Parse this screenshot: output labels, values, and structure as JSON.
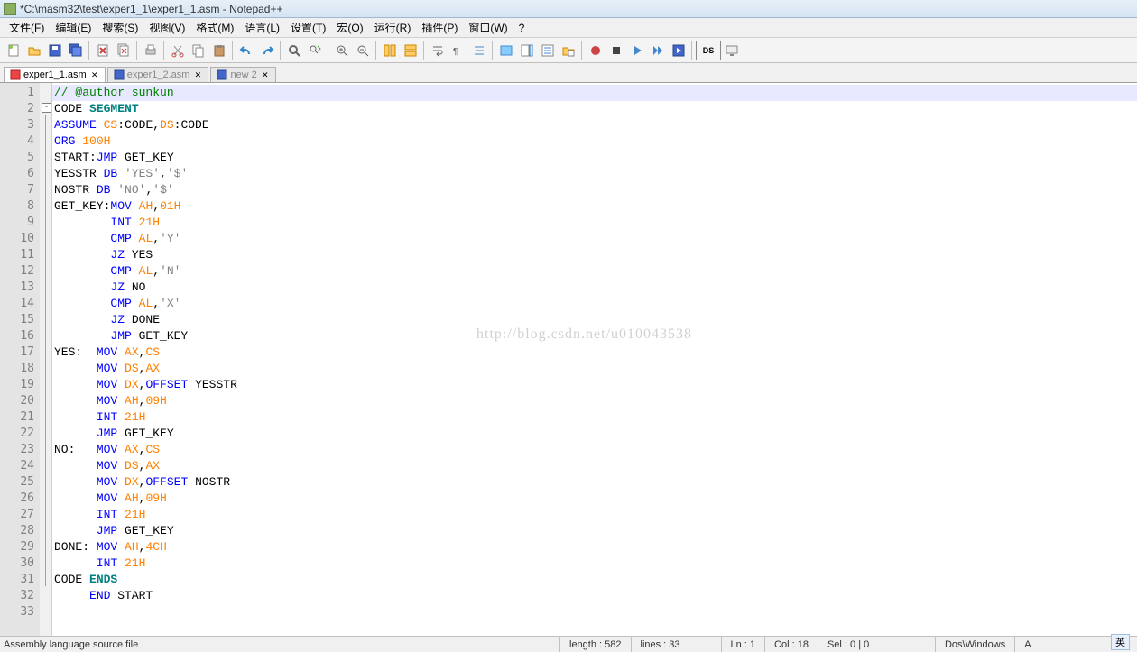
{
  "title": "*C:\\masm32\\test\\exper1_1\\exper1_1.asm - Notepad++",
  "menus": [
    "文件(F)",
    "编辑(E)",
    "搜索(S)",
    "视图(V)",
    "格式(M)",
    "语言(L)",
    "设置(T)",
    "宏(O)",
    "运行(R)",
    "插件(P)",
    "窗口(W)",
    "?"
  ],
  "tabs": [
    {
      "label": "exper1_1.asm",
      "active": true,
      "modified": true
    },
    {
      "label": "exper1_2.asm",
      "active": false,
      "modified": false
    },
    {
      "label": "new  2",
      "active": false,
      "modified": false
    }
  ],
  "watermark": "http://blog.csdn.net/u010043538",
  "code": [
    {
      "n": 1,
      "segs": [
        {
          "t": "// @author sunkun",
          "c": "kw-comment"
        }
      ]
    },
    {
      "n": 2,
      "segs": [
        {
          "t": "CODE "
        },
        {
          "t": "SEGMENT",
          "c": "kw-teal"
        }
      ]
    },
    {
      "n": 3,
      "segs": [
        {
          "t": "ASSUME",
          "c": "kw-blue"
        },
        {
          "t": " "
        },
        {
          "t": "CS",
          "c": "kw-orange"
        },
        {
          "t": ":CODE,"
        },
        {
          "t": "DS",
          "c": "kw-orange"
        },
        {
          "t": ":CODE"
        }
      ]
    },
    {
      "n": 4,
      "segs": [
        {
          "t": "ORG",
          "c": "kw-blue"
        },
        {
          "t": " "
        },
        {
          "t": "100H",
          "c": "kw-orange"
        }
      ]
    },
    {
      "n": 5,
      "segs": [
        {
          "t": "START:"
        },
        {
          "t": "JMP",
          "c": "kw-blue"
        },
        {
          "t": " GET_KEY"
        }
      ]
    },
    {
      "n": 6,
      "segs": [
        {
          "t": "YESSTR "
        },
        {
          "t": "DB",
          "c": "kw-blue"
        },
        {
          "t": " "
        },
        {
          "t": "'YES'",
          "c": "kw-str"
        },
        {
          "t": ","
        },
        {
          "t": "'$'",
          "c": "kw-str"
        }
      ]
    },
    {
      "n": 7,
      "segs": [
        {
          "t": "NOSTR "
        },
        {
          "t": "DB",
          "c": "kw-blue"
        },
        {
          "t": " "
        },
        {
          "t": "'NO'",
          "c": "kw-str"
        },
        {
          "t": ","
        },
        {
          "t": "'$'",
          "c": "kw-str"
        }
      ]
    },
    {
      "n": 8,
      "segs": [
        {
          "t": "GET_KEY:"
        },
        {
          "t": "MOV",
          "c": "kw-blue"
        },
        {
          "t": " "
        },
        {
          "t": "AH",
          "c": "kw-orange"
        },
        {
          "t": ","
        },
        {
          "t": "01H",
          "c": "kw-orange"
        }
      ]
    },
    {
      "n": 9,
      "segs": [
        {
          "t": "        "
        },
        {
          "t": "INT",
          "c": "kw-blue"
        },
        {
          "t": " "
        },
        {
          "t": "21H",
          "c": "kw-orange"
        }
      ]
    },
    {
      "n": 10,
      "segs": [
        {
          "t": "        "
        },
        {
          "t": "CMP",
          "c": "kw-blue"
        },
        {
          "t": " "
        },
        {
          "t": "AL",
          "c": "kw-orange"
        },
        {
          "t": ","
        },
        {
          "t": "'Y'",
          "c": "kw-str"
        }
      ]
    },
    {
      "n": 11,
      "segs": [
        {
          "t": "        "
        },
        {
          "t": "JZ",
          "c": "kw-blue"
        },
        {
          "t": " YES"
        }
      ]
    },
    {
      "n": 12,
      "segs": [
        {
          "t": "        "
        },
        {
          "t": "CMP",
          "c": "kw-blue"
        },
        {
          "t": " "
        },
        {
          "t": "AL",
          "c": "kw-orange"
        },
        {
          "t": ","
        },
        {
          "t": "'N'",
          "c": "kw-str"
        }
      ]
    },
    {
      "n": 13,
      "segs": [
        {
          "t": "        "
        },
        {
          "t": "JZ",
          "c": "kw-blue"
        },
        {
          "t": " NO"
        }
      ]
    },
    {
      "n": 14,
      "segs": [
        {
          "t": "        "
        },
        {
          "t": "CMP",
          "c": "kw-blue"
        },
        {
          "t": " "
        },
        {
          "t": "AL",
          "c": "kw-orange"
        },
        {
          "t": ","
        },
        {
          "t": "'X'",
          "c": "kw-str"
        }
      ]
    },
    {
      "n": 15,
      "segs": [
        {
          "t": "        "
        },
        {
          "t": "JZ",
          "c": "kw-blue"
        },
        {
          "t": " DONE"
        }
      ]
    },
    {
      "n": 16,
      "segs": [
        {
          "t": "        "
        },
        {
          "t": "JMP",
          "c": "kw-blue"
        },
        {
          "t": " GET_KEY"
        }
      ]
    },
    {
      "n": 17,
      "segs": [
        {
          "t": "YES:  "
        },
        {
          "t": "MOV",
          "c": "kw-blue"
        },
        {
          "t": " "
        },
        {
          "t": "AX",
          "c": "kw-orange"
        },
        {
          "t": ","
        },
        {
          "t": "CS",
          "c": "kw-orange"
        }
      ]
    },
    {
      "n": 18,
      "segs": [
        {
          "t": "      "
        },
        {
          "t": "MOV",
          "c": "kw-blue"
        },
        {
          "t": " "
        },
        {
          "t": "DS",
          "c": "kw-orange"
        },
        {
          "t": ","
        },
        {
          "t": "AX",
          "c": "kw-orange"
        }
      ]
    },
    {
      "n": 19,
      "segs": [
        {
          "t": "      "
        },
        {
          "t": "MOV",
          "c": "kw-blue"
        },
        {
          "t": " "
        },
        {
          "t": "DX",
          "c": "kw-orange"
        },
        {
          "t": ","
        },
        {
          "t": "OFFSET",
          "c": "kw-blue"
        },
        {
          "t": " YESSTR"
        }
      ]
    },
    {
      "n": 20,
      "segs": [
        {
          "t": "      "
        },
        {
          "t": "MOV",
          "c": "kw-blue"
        },
        {
          "t": " "
        },
        {
          "t": "AH",
          "c": "kw-orange"
        },
        {
          "t": ","
        },
        {
          "t": "09H",
          "c": "kw-orange"
        }
      ]
    },
    {
      "n": 21,
      "segs": [
        {
          "t": "      "
        },
        {
          "t": "INT",
          "c": "kw-blue"
        },
        {
          "t": " "
        },
        {
          "t": "21H",
          "c": "kw-orange"
        }
      ]
    },
    {
      "n": 22,
      "segs": [
        {
          "t": "      "
        },
        {
          "t": "JMP",
          "c": "kw-blue"
        },
        {
          "t": " GET_KEY"
        }
      ]
    },
    {
      "n": 23,
      "segs": [
        {
          "t": "NO:   "
        },
        {
          "t": "MOV",
          "c": "kw-blue"
        },
        {
          "t": " "
        },
        {
          "t": "AX",
          "c": "kw-orange"
        },
        {
          "t": ","
        },
        {
          "t": "CS",
          "c": "kw-orange"
        }
      ]
    },
    {
      "n": 24,
      "segs": [
        {
          "t": "      "
        },
        {
          "t": "MOV",
          "c": "kw-blue"
        },
        {
          "t": " "
        },
        {
          "t": "DS",
          "c": "kw-orange"
        },
        {
          "t": ","
        },
        {
          "t": "AX",
          "c": "kw-orange"
        }
      ]
    },
    {
      "n": 25,
      "segs": [
        {
          "t": "      "
        },
        {
          "t": "MOV",
          "c": "kw-blue"
        },
        {
          "t": " "
        },
        {
          "t": "DX",
          "c": "kw-orange"
        },
        {
          "t": ","
        },
        {
          "t": "OFFSET",
          "c": "kw-blue"
        },
        {
          "t": " NOSTR"
        }
      ]
    },
    {
      "n": 26,
      "segs": [
        {
          "t": "      "
        },
        {
          "t": "MOV",
          "c": "kw-blue"
        },
        {
          "t": " "
        },
        {
          "t": "AH",
          "c": "kw-orange"
        },
        {
          "t": ","
        },
        {
          "t": "09H",
          "c": "kw-orange"
        }
      ]
    },
    {
      "n": 27,
      "segs": [
        {
          "t": "      "
        },
        {
          "t": "INT",
          "c": "kw-blue"
        },
        {
          "t": " "
        },
        {
          "t": "21H",
          "c": "kw-orange"
        }
      ]
    },
    {
      "n": 28,
      "segs": [
        {
          "t": "      "
        },
        {
          "t": "JMP",
          "c": "kw-blue"
        },
        {
          "t": " GET_KEY"
        }
      ]
    },
    {
      "n": 29,
      "segs": [
        {
          "t": "DONE: "
        },
        {
          "t": "MOV",
          "c": "kw-blue"
        },
        {
          "t": " "
        },
        {
          "t": "AH",
          "c": "kw-orange"
        },
        {
          "t": ","
        },
        {
          "t": "4CH",
          "c": "kw-orange"
        }
      ]
    },
    {
      "n": 30,
      "segs": [
        {
          "t": "      "
        },
        {
          "t": "INT",
          "c": "kw-blue"
        },
        {
          "t": " "
        },
        {
          "t": "21H",
          "c": "kw-orange"
        }
      ]
    },
    {
      "n": 31,
      "segs": [
        {
          "t": "CODE "
        },
        {
          "t": "ENDS",
          "c": "kw-teal"
        }
      ]
    },
    {
      "n": 32,
      "segs": [
        {
          "t": "     "
        },
        {
          "t": "END",
          "c": "kw-blue"
        },
        {
          "t": " START"
        }
      ]
    },
    {
      "n": 33,
      "segs": [
        {
          "t": ""
        }
      ]
    }
  ],
  "status": {
    "filetype": "Assembly language source file",
    "length_label": "length : 582",
    "lines_label": "lines : 33",
    "ln": "Ln : 1",
    "col": "Col : 18",
    "sel": "Sel : 0 | 0",
    "eol": "Dos\\Windows",
    "enc": "A"
  },
  "lang_badge": "英"
}
